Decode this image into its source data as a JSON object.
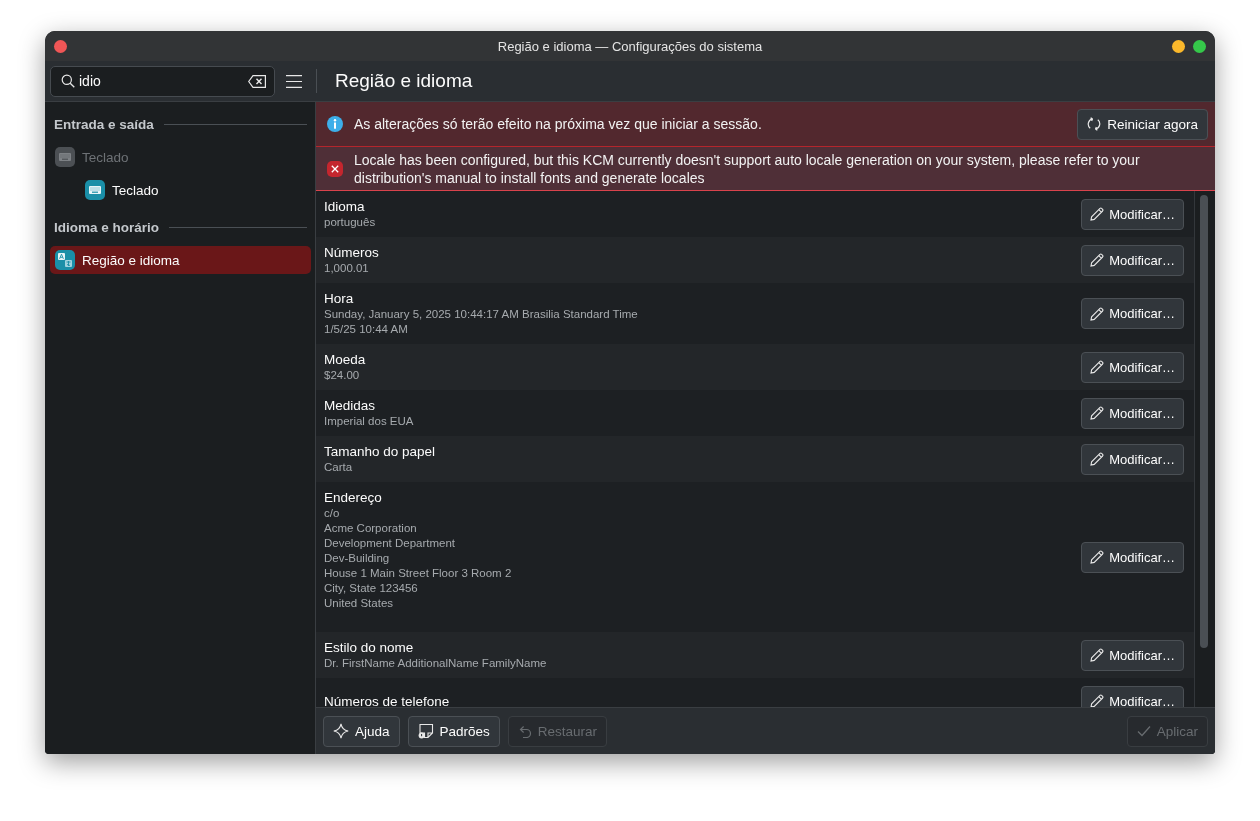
{
  "window": {
    "title": "Região e idioma — Configurações do sistema"
  },
  "toolbar": {
    "search": {
      "value": "idio"
    },
    "page_title": "Região e idioma"
  },
  "sidebar": {
    "sections": [
      {
        "heading": "Entrada e saída",
        "items": [
          {
            "label": "Teclado",
            "disabled": true,
            "selected": false,
            "children": [
              {
                "label": "Teclado",
                "disabled": false,
                "selected": false
              }
            ]
          }
        ]
      },
      {
        "heading": "Idioma e horário",
        "items": [
          {
            "label": "Região e idioma",
            "disabled": false,
            "selected": true
          }
        ]
      }
    ]
  },
  "banners": [
    {
      "kind": "info",
      "text": "As alterações só terão efeito na próxima vez que iniciar a sessão.",
      "button": "Reiniciar agora"
    },
    {
      "kind": "error",
      "text": "Locale has been configured, but this KCM currently doesn't support auto locale generation on your system, please refer to your distribution's manual to install fonts and generate locales"
    }
  ],
  "settings": [
    {
      "title": "Idioma",
      "values": [
        "português"
      ],
      "button": "Modificar…"
    },
    {
      "title": "Números",
      "values": [
        "1,000.01"
      ],
      "button": "Modificar…"
    },
    {
      "title": "Hora",
      "values": [
        "Sunday, January 5, 2025 10:44:17 AM Brasilia Standard Time",
        "1/5/25 10:44 AM"
      ],
      "button": "Modificar…"
    },
    {
      "title": "Moeda",
      "values": [
        "$24.00"
      ],
      "button": "Modificar…"
    },
    {
      "title": "Medidas",
      "values": [
        "Imperial dos EUA"
      ],
      "button": "Modificar…"
    },
    {
      "title": "Tamanho do papel",
      "values": [
        "Carta"
      ],
      "button": "Modificar…"
    },
    {
      "title": "Endereço",
      "values": [
        "c/o",
        "Acme Corporation",
        "Development Department",
        "Dev-Building",
        "House 1 Main Street Floor 3 Room 2",
        "City, State 123456",
        "United States"
      ],
      "button": "Modificar…"
    },
    {
      "title": "Estilo do nome",
      "values": [
        "Dr. FirstName AdditionalName FamilyName"
      ],
      "button": "Modificar…"
    },
    {
      "title": "Números de telefone",
      "button": "Modificar…"
    }
  ],
  "footer": {
    "left": [
      {
        "label": "Ajuda",
        "disabled": false
      },
      {
        "label": "Padrões",
        "disabled": false
      },
      {
        "label": "Restaurar",
        "disabled": true
      }
    ],
    "right": [
      {
        "label": "Aplicar",
        "disabled": true
      }
    ]
  }
}
